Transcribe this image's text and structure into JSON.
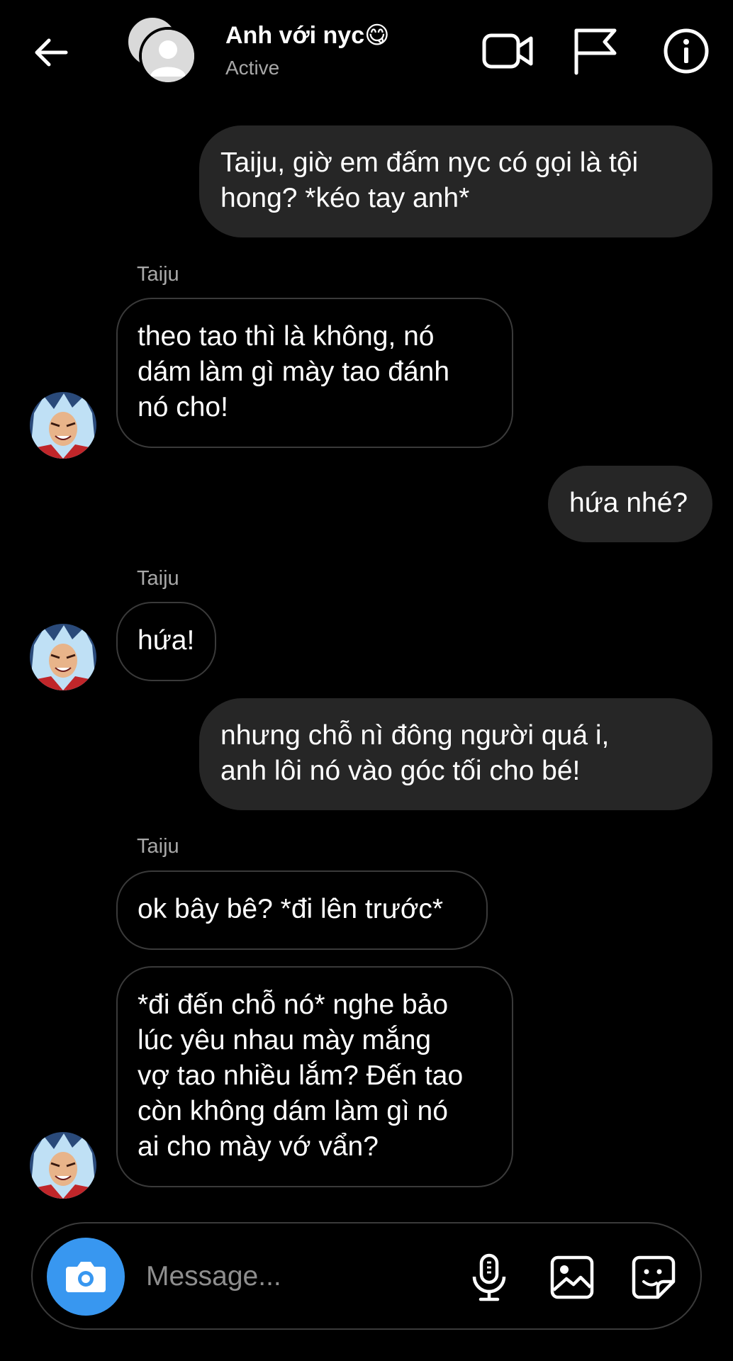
{
  "header": {
    "title": "Anh với nyc😋",
    "status": "Active",
    "icons": [
      "back-arrow-icon",
      "video-call-icon",
      "flag-icon",
      "info-icon"
    ]
  },
  "messages": [
    {
      "direction": "outgoing",
      "text": "Taiju, giờ em đấm nyc có gọi là tội\nhong? *kéo tay anh*"
    },
    {
      "direction": "incoming",
      "sender": "Taiju",
      "text": "theo tao thì là không, nó\ndám làm gì mày tao đánh\nnó cho!"
    },
    {
      "direction": "outgoing",
      "text": "hứa nhé?"
    },
    {
      "direction": "incoming",
      "sender": "Taiju",
      "text": "hứa!"
    },
    {
      "direction": "outgoing",
      "text": "nhưng chỗ nì đông người quá i,\nanh lôi nó vào góc tối cho bé!"
    },
    {
      "direction": "incoming",
      "sender": "Taiju",
      "text": "ok bây bê? *đi lên trước*"
    },
    {
      "direction": "incoming",
      "text": "*đi đến chỗ nó* nghe bảo\nlúc yêu nhau mày mắng\nvợ tao nhiều lắm? Đến tao\ncòn không dám làm gì nó\nai cho mày vớ vẩn?"
    }
  ],
  "composer": {
    "placeholder": "Message...",
    "icons": [
      "camera-icon",
      "microphone-icon",
      "gallery-icon",
      "sticker-icon"
    ]
  },
  "colors": {
    "background": "#000000",
    "outgoing_bubble": "#262626",
    "incoming_border": "#3a3a3a",
    "secondary_text": "#a8a8a8",
    "accent": "#3897f0"
  }
}
